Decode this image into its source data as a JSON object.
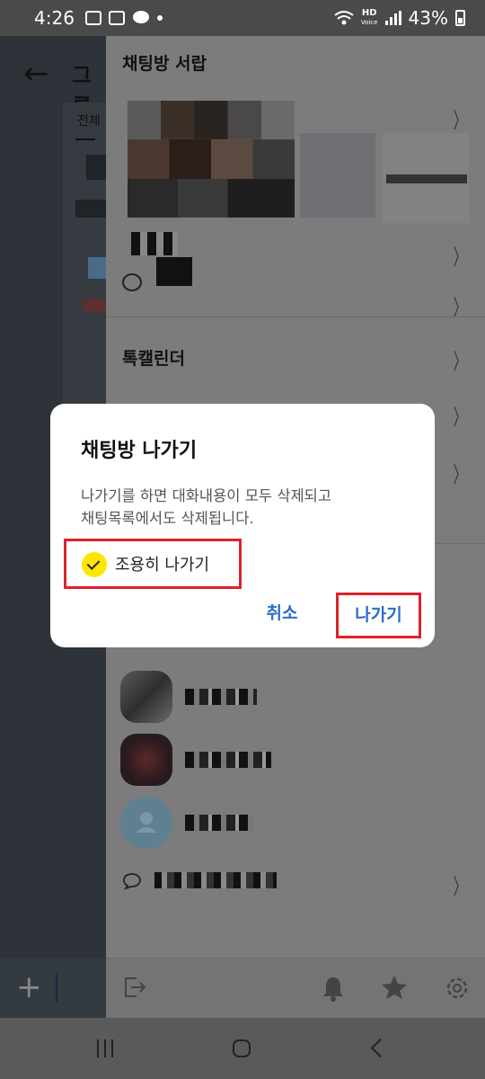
{
  "status_bar": {
    "time": "4:26",
    "battery": "43%",
    "hd_label": "HD",
    "voice_label": "Voice"
  },
  "underlying_screen": {
    "title_fragment": "그룹",
    "tab_all": "전체"
  },
  "drawer": {
    "title": "채팅방 서랍",
    "talk_calendar": "톡캘린더"
  },
  "dialog": {
    "title": "채팅방 나가기",
    "message_line1": "나가기를 하면 대화내용이 모두 삭제되고",
    "message_line2": "채팅목록에서도 삭제됩니다.",
    "quiet_leave_label": "조용히 나가기",
    "quiet_leave_checked": true,
    "cancel_label": "취소",
    "leave_label": "나가기"
  },
  "colors": {
    "accent_blue": "#2a6dcc",
    "check_yellow": "#fee500",
    "highlight_red": "#e0222a"
  }
}
